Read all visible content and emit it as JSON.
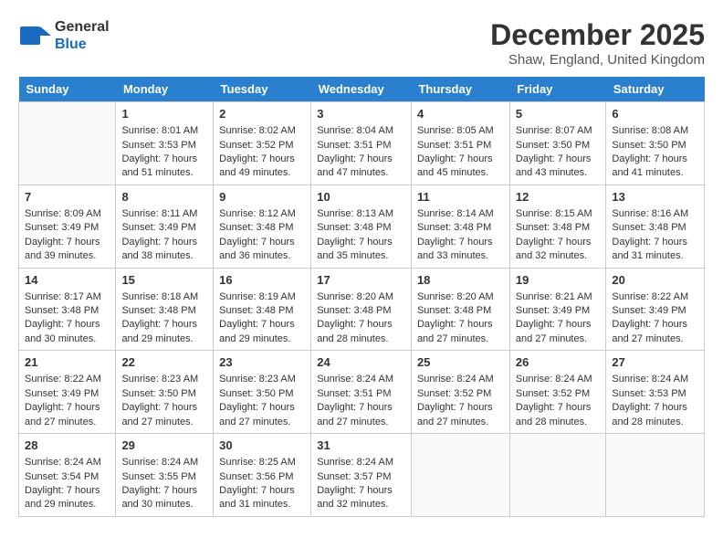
{
  "header": {
    "logo_line1": "General",
    "logo_line2": "Blue",
    "month": "December 2025",
    "location": "Shaw, England, United Kingdom"
  },
  "weekdays": [
    "Sunday",
    "Monday",
    "Tuesday",
    "Wednesday",
    "Thursday",
    "Friday",
    "Saturday"
  ],
  "weeks": [
    [
      {
        "day": "",
        "empty": true
      },
      {
        "day": "1",
        "sunrise": "8:01 AM",
        "sunset": "3:53 PM",
        "daylight": "7 hours and 51 minutes."
      },
      {
        "day": "2",
        "sunrise": "8:02 AM",
        "sunset": "3:52 PM",
        "daylight": "7 hours and 49 minutes."
      },
      {
        "day": "3",
        "sunrise": "8:04 AM",
        "sunset": "3:51 PM",
        "daylight": "7 hours and 47 minutes."
      },
      {
        "day": "4",
        "sunrise": "8:05 AM",
        "sunset": "3:51 PM",
        "daylight": "7 hours and 45 minutes."
      },
      {
        "day": "5",
        "sunrise": "8:07 AM",
        "sunset": "3:50 PM",
        "daylight": "7 hours and 43 minutes."
      },
      {
        "day": "6",
        "sunrise": "8:08 AM",
        "sunset": "3:50 PM",
        "daylight": "7 hours and 41 minutes."
      }
    ],
    [
      {
        "day": "7",
        "sunrise": "8:09 AM",
        "sunset": "3:49 PM",
        "daylight": "7 hours and 39 minutes."
      },
      {
        "day": "8",
        "sunrise": "8:11 AM",
        "sunset": "3:49 PM",
        "daylight": "7 hours and 38 minutes."
      },
      {
        "day": "9",
        "sunrise": "8:12 AM",
        "sunset": "3:48 PM",
        "daylight": "7 hours and 36 minutes."
      },
      {
        "day": "10",
        "sunrise": "8:13 AM",
        "sunset": "3:48 PM",
        "daylight": "7 hours and 35 minutes."
      },
      {
        "day": "11",
        "sunrise": "8:14 AM",
        "sunset": "3:48 PM",
        "daylight": "7 hours and 33 minutes."
      },
      {
        "day": "12",
        "sunrise": "8:15 AM",
        "sunset": "3:48 PM",
        "daylight": "7 hours and 32 minutes."
      },
      {
        "day": "13",
        "sunrise": "8:16 AM",
        "sunset": "3:48 PM",
        "daylight": "7 hours and 31 minutes."
      }
    ],
    [
      {
        "day": "14",
        "sunrise": "8:17 AM",
        "sunset": "3:48 PM",
        "daylight": "7 hours and 30 minutes."
      },
      {
        "day": "15",
        "sunrise": "8:18 AM",
        "sunset": "3:48 PM",
        "daylight": "7 hours and 29 minutes."
      },
      {
        "day": "16",
        "sunrise": "8:19 AM",
        "sunset": "3:48 PM",
        "daylight": "7 hours and 29 minutes."
      },
      {
        "day": "17",
        "sunrise": "8:20 AM",
        "sunset": "3:48 PM",
        "daylight": "7 hours and 28 minutes."
      },
      {
        "day": "18",
        "sunrise": "8:20 AM",
        "sunset": "3:48 PM",
        "daylight": "7 hours and 27 minutes."
      },
      {
        "day": "19",
        "sunrise": "8:21 AM",
        "sunset": "3:49 PM",
        "daylight": "7 hours and 27 minutes."
      },
      {
        "day": "20",
        "sunrise": "8:22 AM",
        "sunset": "3:49 PM",
        "daylight": "7 hours and 27 minutes."
      }
    ],
    [
      {
        "day": "21",
        "sunrise": "8:22 AM",
        "sunset": "3:49 PM",
        "daylight": "7 hours and 27 minutes."
      },
      {
        "day": "22",
        "sunrise": "8:23 AM",
        "sunset": "3:50 PM",
        "daylight": "7 hours and 27 minutes."
      },
      {
        "day": "23",
        "sunrise": "8:23 AM",
        "sunset": "3:50 PM",
        "daylight": "7 hours and 27 minutes."
      },
      {
        "day": "24",
        "sunrise": "8:24 AM",
        "sunset": "3:51 PM",
        "daylight": "7 hours and 27 minutes."
      },
      {
        "day": "25",
        "sunrise": "8:24 AM",
        "sunset": "3:52 PM",
        "daylight": "7 hours and 27 minutes."
      },
      {
        "day": "26",
        "sunrise": "8:24 AM",
        "sunset": "3:52 PM",
        "daylight": "7 hours and 28 minutes."
      },
      {
        "day": "27",
        "sunrise": "8:24 AM",
        "sunset": "3:53 PM",
        "daylight": "7 hours and 28 minutes."
      }
    ],
    [
      {
        "day": "28",
        "sunrise": "8:24 AM",
        "sunset": "3:54 PM",
        "daylight": "7 hours and 29 minutes."
      },
      {
        "day": "29",
        "sunrise": "8:24 AM",
        "sunset": "3:55 PM",
        "daylight": "7 hours and 30 minutes."
      },
      {
        "day": "30",
        "sunrise": "8:25 AM",
        "sunset": "3:56 PM",
        "daylight": "7 hours and 31 minutes."
      },
      {
        "day": "31",
        "sunrise": "8:24 AM",
        "sunset": "3:57 PM",
        "daylight": "7 hours and 32 minutes."
      },
      {
        "day": "",
        "empty": true
      },
      {
        "day": "",
        "empty": true
      },
      {
        "day": "",
        "empty": true
      }
    ]
  ]
}
